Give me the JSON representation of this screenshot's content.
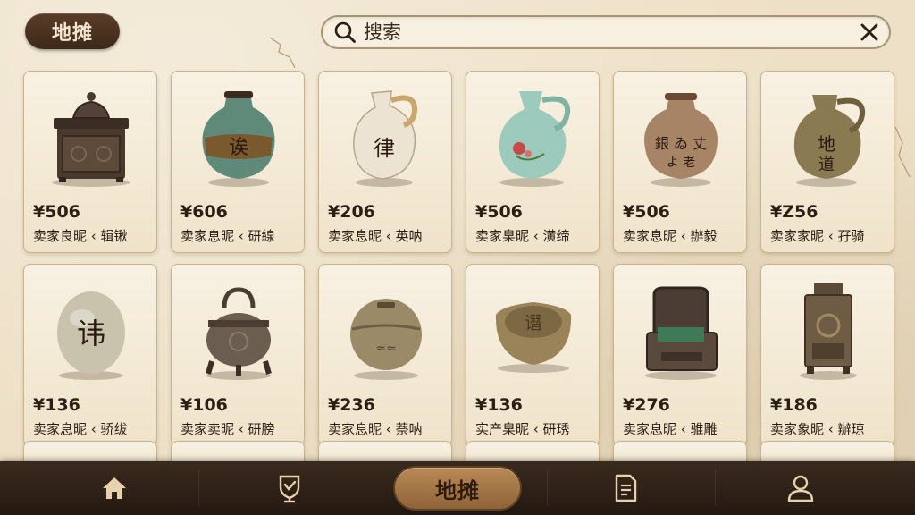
{
  "header": {
    "title": "地摊",
    "search_placeholder": "搜索"
  },
  "items": [
    {
      "icon": "bronze-box-icon",
      "price": "¥506",
      "seller": "卖家良昵 ‹ 辑锹"
    },
    {
      "icon": "painted-jar-icon",
      "price": "¥606",
      "seller": "卖家息昵 ‹ 研線"
    },
    {
      "icon": "white-ewer-icon",
      "price": "¥206",
      "seller": "卖家息昵 ‹ 英呐"
    },
    {
      "icon": "celadon-ewer-icon",
      "price": "¥506",
      "seller": "卖家臬昵 ‹ 潢缔"
    },
    {
      "icon": "inscribed-jar-icon",
      "price": "¥506",
      "seller": "卖家息昵 ‹ 辦毅"
    },
    {
      "icon": "olive-jug-icon",
      "price": "¥Z56",
      "seller": "卖家家昵 ‹ 孖骑"
    },
    {
      "icon": "carved-stone-icon",
      "price": "¥136",
      "seller": "卖家息昵 ‹ 骄绂"
    },
    {
      "icon": "bronze-censer-icon",
      "price": "¥106",
      "seller": "卖家卖昵 ‹ 研膀"
    },
    {
      "icon": "bronze-bell-icon",
      "price": "¥236",
      "seller": "卖家息昵 ‹ 萘呐"
    },
    {
      "icon": "bronze-bowl-icon",
      "price": "¥136",
      "seller": "实产臬昵 ‹ 研琇"
    },
    {
      "icon": "inkstone-box-icon",
      "price": "¥276",
      "seller": "卖家息昵 ‹ 骓雕"
    },
    {
      "icon": "bronze-lantern-icon",
      "price": "¥186",
      "seller": "卖家象昵 ‹ 辦琼"
    }
  ],
  "nav": {
    "items": [
      {
        "name": "home",
        "icon": "home-icon"
      },
      {
        "name": "collection",
        "icon": "trophy-shield-icon"
      },
      {
        "name": "market",
        "label": "地摊",
        "active": true
      },
      {
        "name": "records",
        "icon": "document-icon"
      },
      {
        "name": "profile",
        "icon": "user-icon"
      }
    ]
  },
  "colors": {
    "background": "#ede0c6",
    "card": "#f8f1e2",
    "accent_dark": "#3d2819",
    "nav_active": "#b98a55"
  }
}
